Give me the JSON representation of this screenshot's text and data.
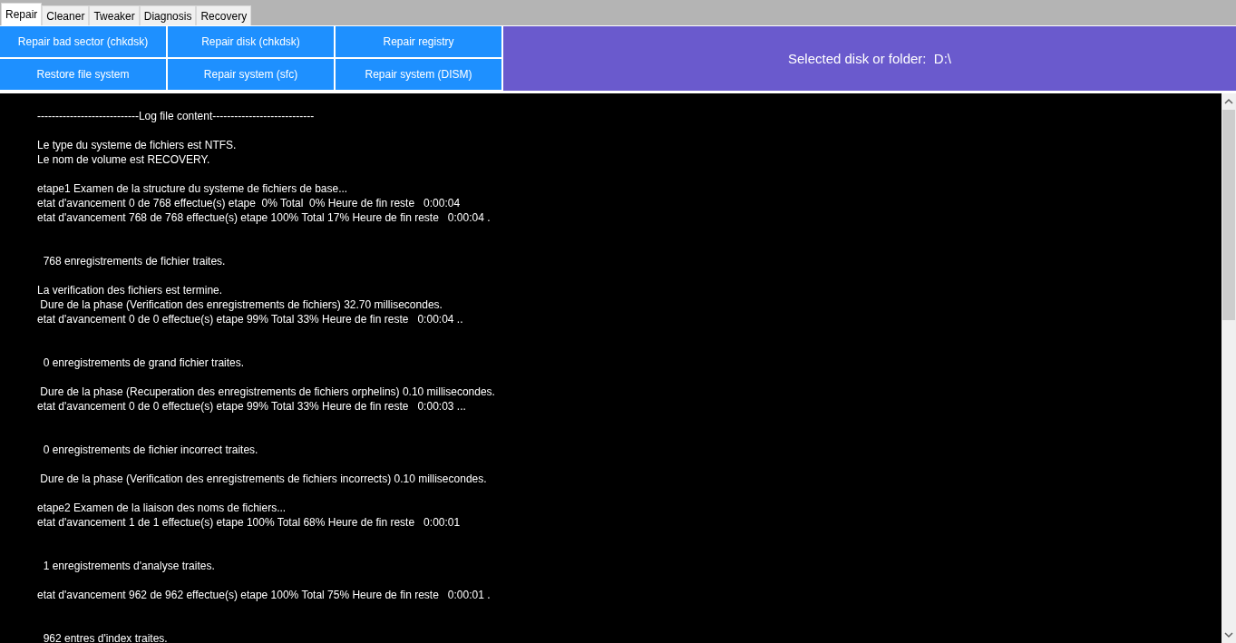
{
  "tabs": [
    {
      "label": "Repair",
      "selected": true
    },
    {
      "label": "Cleaner",
      "selected": false
    },
    {
      "label": "Tweaker",
      "selected": false
    },
    {
      "label": "Diagnosis",
      "selected": false
    },
    {
      "label": "Recovery",
      "selected": false
    }
  ],
  "buttons": [
    [
      "Repair bad sector (chkdsk)",
      "Repair disk (chkdsk)",
      "Repair registry"
    ],
    [
      "Restore file system",
      "Repair system (sfc)",
      "Repair system (DISM)"
    ]
  ],
  "selected_target": "Selected disk or folder:  D:\\",
  "log": [
    {
      "kind": "normal",
      "lines": [
        "----------------------------Log file content----------------------------"
      ]
    },
    {
      "kind": "normal",
      "lines": [
        "Le type du systeme de fichiers est NTFS.",
        "Le nom de volume est RECOVERY."
      ]
    },
    {
      "kind": "normal",
      "lines": [
        "etape1 Examen de la structure du systeme de fichiers de base...",
        "etat d'avancement 0 de 768 effectue(s) etape  0% Total  0% Heure de fin reste   0:00:04",
        "etat d'avancement 768 de 768 effectue(s) etape 100% Total 17% Heure de fin reste   0:00:04 ."
      ]
    },
    {
      "kind": "spaced",
      "lines": [
        "  768 enregistrements de fichier traites."
      ]
    },
    {
      "kind": "normal",
      "lines": [
        "La verification des fichiers est termine.",
        " Dure de la phase (Verification des enregistrements de fichiers) 32.70 millisecondes.",
        "etat d'avancement 0 de 0 effectue(s) etape 99% Total 33% Heure de fin reste   0:00:04 .."
      ]
    },
    {
      "kind": "spaced",
      "lines": [
        "  0 enregistrements de grand fichier traites."
      ]
    },
    {
      "kind": "normal",
      "lines": [
        " Dure de la phase (Recuperation des enregistrements de fichiers orphelins) 0.10 millisecondes.",
        "etat d'avancement 0 de 0 effectue(s) etape 99% Total 33% Heure de fin reste   0:00:03 ..."
      ]
    },
    {
      "kind": "spaced",
      "lines": [
        "  0 enregistrements de fichier incorrect traites."
      ]
    },
    {
      "kind": "normal",
      "lines": [
        " Dure de la phase (Verification des enregistrements de fichiers incorrects) 0.10 millisecondes."
      ]
    },
    {
      "kind": "normal",
      "lines": [
        "etape2 Examen de la liaison des noms de fichiers...",
        "etat d'avancement 1 de 1 effectue(s) etape 100% Total 68% Heure de fin reste   0:00:01"
      ]
    },
    {
      "kind": "spaced",
      "lines": [
        "  1 enregistrements d'analyse traites."
      ]
    },
    {
      "kind": "normal",
      "lines": [
        "etat d'avancement 962 de 962 effectue(s) etape 100% Total 75% Heure de fin reste   0:00:01 ."
      ]
    },
    {
      "kind": "spaced",
      "lines": [
        "  962 entres d'index traites."
      ]
    }
  ]
}
